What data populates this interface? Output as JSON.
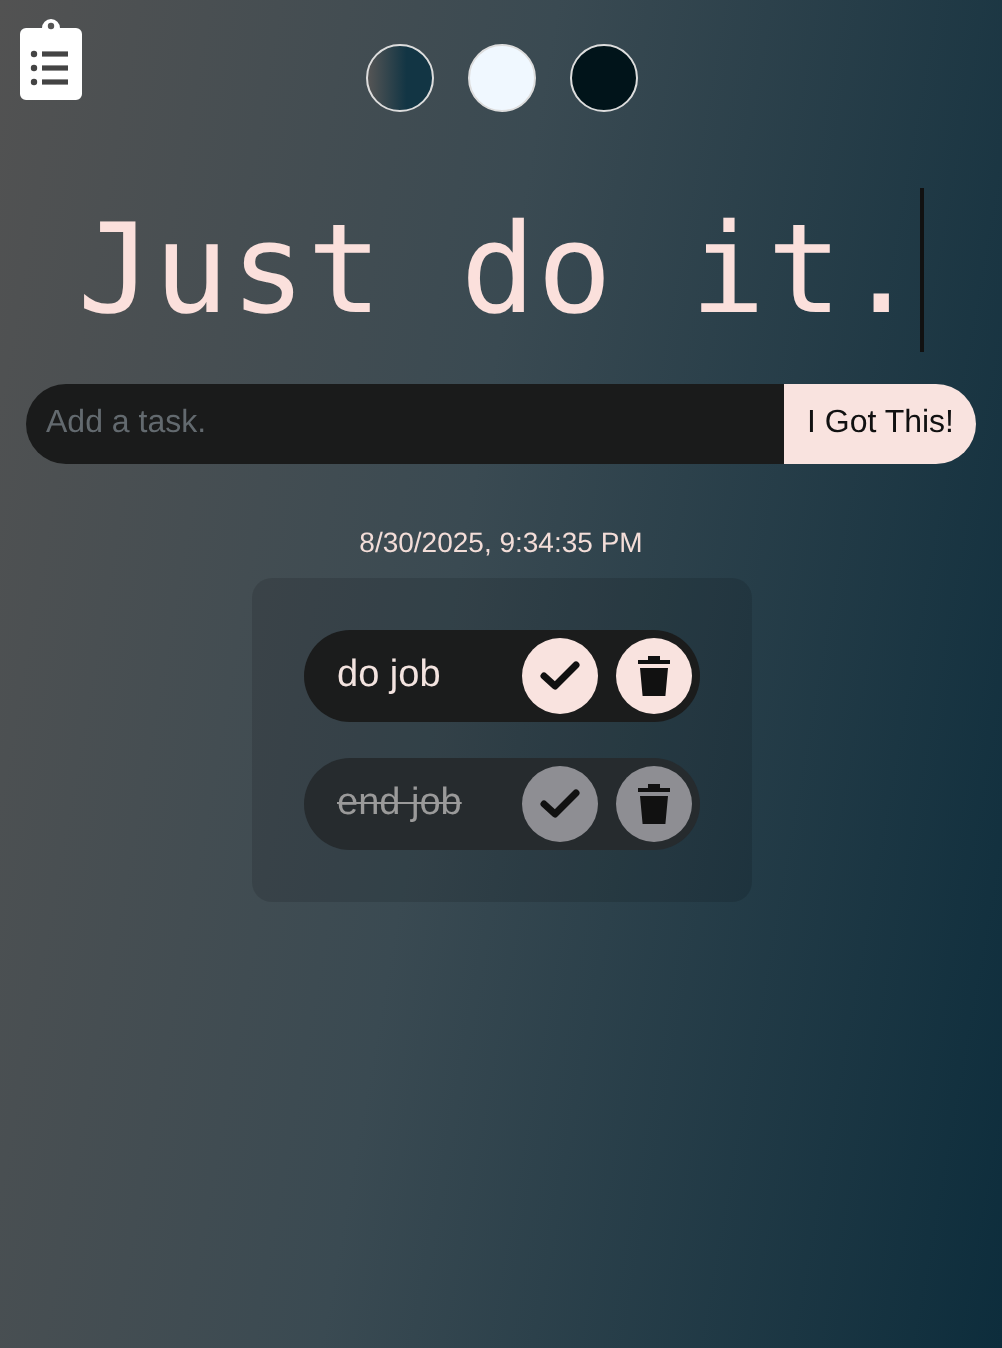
{
  "themes": [
    {
      "kind": "gradient",
      "color": "#123544"
    },
    {
      "kind": "solid",
      "color": "#f0f8ff"
    },
    {
      "kind": "solid",
      "color": "#01141a"
    }
  ],
  "title": "Just do it.",
  "task_input": {
    "placeholder": "Add a task."
  },
  "add_button": "I Got This!",
  "datetime": "8/30/2025, 9:34:35 PM",
  "tasks": [
    {
      "text": "do job",
      "completed": false
    },
    {
      "text": "end job",
      "completed": true
    }
  ]
}
